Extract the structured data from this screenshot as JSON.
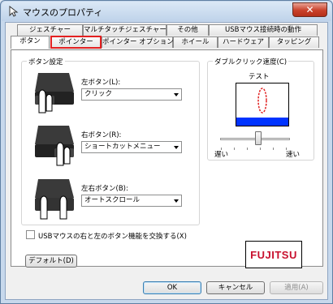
{
  "window": {
    "title": "マウスのプロパティ",
    "close_glyph": "✕"
  },
  "tabs_row_back": [
    {
      "label": "ジェスチャー"
    },
    {
      "label": "マルチタッチジェスチャー"
    },
    {
      "label": "その他"
    },
    {
      "label": "USBマウス接続時の動作"
    }
  ],
  "tabs_row_front": [
    {
      "label": "ボタン",
      "selected": true
    },
    {
      "label": "ポインター",
      "highlighted": true
    },
    {
      "label": "ポインター オプション"
    },
    {
      "label": "ホイール"
    },
    {
      "label": "ハードウェア"
    },
    {
      "label": "タッピング"
    }
  ],
  "button_settings": {
    "group_label": "ボタン設定",
    "left": {
      "label": "左ボタン(L):",
      "value": "クリック"
    },
    "right": {
      "label": "右ボタン(R):",
      "value": "ショートカットメニュー"
    },
    "both": {
      "label": "左右ボタン(B):",
      "value": "オートスクロール"
    }
  },
  "double_click": {
    "group_label": "ダブルクリック速度(C)",
    "test_label": "テスト",
    "slow_label": "遅い",
    "fast_label": "速い",
    "speed_fraction": 0.55
  },
  "swap_checkbox": {
    "label": "USBマウスの右と左のボタン機能を交換する(X)",
    "checked": false
  },
  "default_button": "デフォルト(D)",
  "logo_text": "FUJITSU",
  "footer": {
    "ok": "OK",
    "cancel": "キャンセル",
    "apply": "適用(A)"
  },
  "colors": {
    "highlight": "#e32020",
    "test_blue": "#0033ff",
    "oval": "#e02020",
    "logo": "#c8102e"
  }
}
